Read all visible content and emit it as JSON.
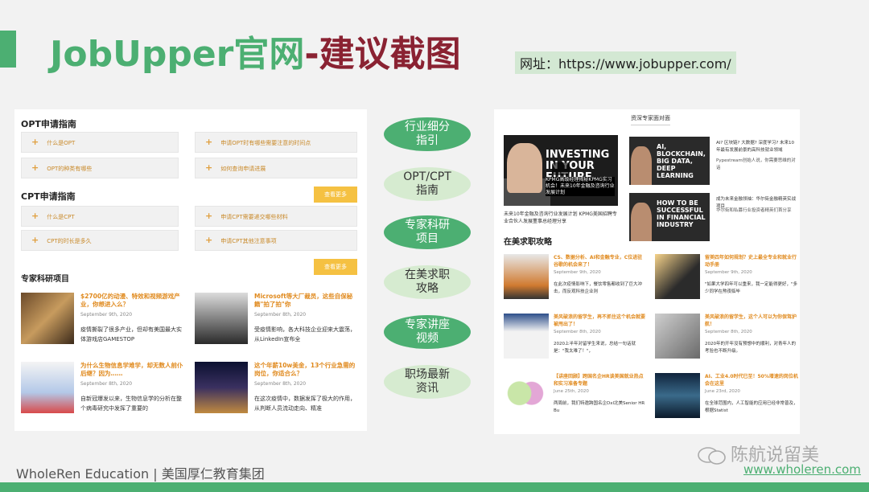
{
  "slide": {
    "title_en": "JobUpper官网",
    "title_dash": "-",
    "title_cn": "建议截图",
    "url_text": "网址：https://www.jobupper.com/",
    "footer_text": "WholeRen Education | 美国厚仁教育集团",
    "watermark": "陈航说留美",
    "footer_url": "www.wholeren.com"
  },
  "colors": {
    "green": "#4caf72",
    "maroon": "#8a2232",
    "orange": "#e08a1e",
    "yellow": "#f5c142"
  },
  "left": {
    "opt_title": "OPT申请指南",
    "opt_items": [
      "什么是OPT",
      "申请OPT时有哪些需要注意的时间点",
      "OPT的种类有哪些",
      "如何查询申请进展"
    ],
    "cpt_title": "CPT申请指南",
    "cpt_items": [
      "什么是CPT",
      "申请CPT需要递交哪些材料",
      "CPT的时长是多久",
      "申请CPT其他注意事项"
    ],
    "more_label": "查看更多",
    "proj_title": "专家科研项目",
    "projects": [
      {
        "title": "$2700亿的动漫、特效和视频游戏产业，你想进入么？",
        "date": "September 9th, 2020",
        "desc": "疫情撕裂了很多产业，但却有美国最大实体游戏店GAMESTOP"
      },
      {
        "title": "Microsoft等大厂裁员，这些自保秘籍\"拍了拍\"你",
        "date": "September 8th, 2020",
        "desc": "受疫情影响，各大科技企业迎来大震荡，从LinkedIn宣布全"
      },
      {
        "title": "为什么生物信息学难学，却无数人前仆后继？因为……",
        "date": "September 8th, 2020",
        "desc": "自新冠爆发以来，生物信息学的分析在整个病毒研究中发挥了重要的"
      },
      {
        "title": "这个年薪10w美金，13个行业急需的岗位，你适合么？",
        "date": "September 8th, 2020",
        "desc": "在这次疫情中，数据发挥了极大的作用，从判断人员流动走向、精准"
      }
    ]
  },
  "pills": [
    "行业细分\n指引",
    "OPT/CPT\n指南",
    "专家科研\n项目",
    "在美求职\n攻略",
    "专家讲座\n视频",
    "职场最新\n资讯"
  ],
  "right": {
    "video_header": "资深专家面对面",
    "big_video_title": "INVESTING IN YOUR FUTURE",
    "big_video_caption": "KPMG高级经理揭秘KPMG实习机会！未来10年金融及咨询行业发展计划",
    "big_caption": "未来10年金融及咨询行业发展计划 KPMG美国招聘专业合伙人发展董事总经理分享",
    "video2_title": "AI, BLOCKCHAIN, BIG DATA, DEEP LEARNING",
    "video2_text": "AI? 区块链? 大数据? 深度学习? 未来10年最有发展前景的高科技就业领域",
    "video2_sub": "Pypestream创始人说，你需要思维的对话",
    "video3_title": "HOW TO BE SUCCESSFUL IN FINANCIAL INDUSTRY",
    "video3_text": "成为未来金融领袖：华尔街金融精英实战项目",
    "video3_sub": "华尔街和私募行业投资者精英们首分享",
    "jobs_title": "在美求职攻略",
    "jobs": [
      {
        "title": "CS、数据分析、AI和金融专业，C位进驻谷歌的机会来了！",
        "date": "September 9th, 2020",
        "desc": "在此次疫情影响下，餐饮零售都收到了巨大冲击，而反观科技企业则"
      },
      {
        "title": "留美四年如何规划？史上最全专业和就业行动手册",
        "date": "September 9th, 2020",
        "desc": "\"如果大学四年可以重来，我一定能得更好，\"多少同学在熬夜临毕"
      },
      {
        "title": "美风破浪的留学生，再不抓住这个机会就要被甩出了！",
        "date": "September 8th, 2020",
        "desc": "2020上半年对留学生来说，总结一句话就是：\"我太难了！\"，"
      },
      {
        "title": "美风破浪的留学生，这个人可以为你保驾护航！",
        "date": "September 8th, 2020",
        "desc": "2020年的开年没有预想中的顺利，对青年人的考验也不断升级。"
      },
      {
        "title": "【讲座回顾】跨国名企HR谈美国就业热点和实习准备专题",
        "date": "June 25th, 2020",
        "desc": "两周前，我们特邀跨国名企Dxl北美Senior HR Bu"
      },
      {
        "title": "AI、工业4.0时代已至！50%增速的岗位机会在这里",
        "date": "June 23rd, 2020",
        "desc": "在全球范围内，人工智能的应用已经非常普及，根据Statist"
      }
    ]
  }
}
